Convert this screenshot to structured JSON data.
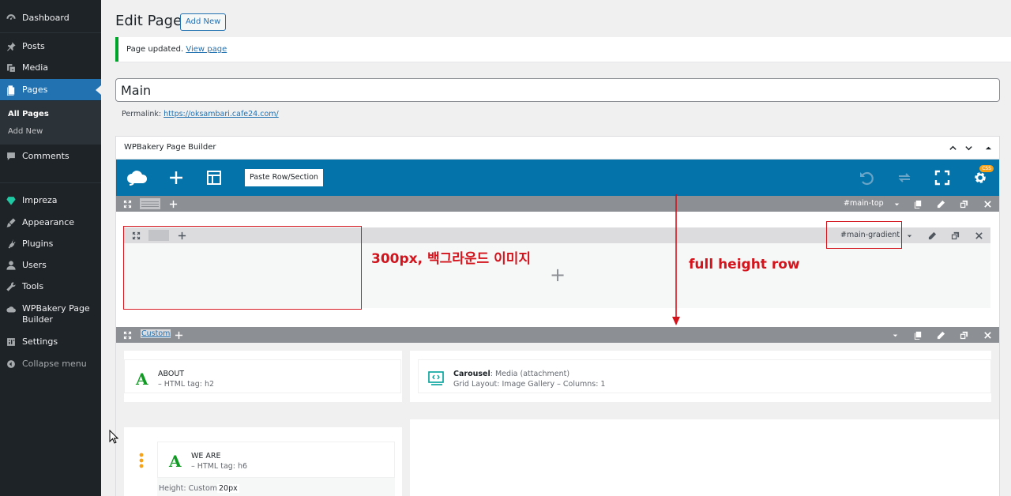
{
  "sidebar": {
    "items": [
      {
        "label": "Dashboard",
        "icon": "dashboard-icon"
      },
      {
        "label": "Posts",
        "icon": "pin-icon"
      },
      {
        "label": "Media",
        "icon": "media-icon"
      },
      {
        "label": "Pages",
        "icon": "pages-icon"
      },
      {
        "label": "Comments",
        "icon": "comment-icon"
      },
      {
        "label": "Impreza",
        "icon": "diamond-icon"
      },
      {
        "label": "Appearance",
        "icon": "brush-icon"
      },
      {
        "label": "Plugins",
        "icon": "plug-icon"
      },
      {
        "label": "Users",
        "icon": "user-icon"
      },
      {
        "label": "Tools",
        "icon": "wrench-icon"
      },
      {
        "label": "WPBakery Page Builder",
        "icon": "cloud-icon"
      },
      {
        "label": "Settings",
        "icon": "settings-icon"
      },
      {
        "label": "Collapse menu",
        "icon": "collapse-icon"
      }
    ],
    "submenu": [
      "All Pages",
      "Add New"
    ],
    "accent": "#2271b1"
  },
  "header": {
    "title": "Edit Page",
    "add_new": "Add New"
  },
  "notice": {
    "text": "Page updated.",
    "link": "View page"
  },
  "editor": {
    "title_value": "Main",
    "permalink_label": "Permalink:",
    "permalink_url": "https://oksambari.cafe24.com/"
  },
  "wpb": {
    "title": "WPBakery Page Builder",
    "paste_label": "Paste Row/Section",
    "css_badge": "CSS",
    "row1_id": "#main-top",
    "inner_id": "#main-gradient",
    "row2_label": "Custom",
    "toolbar_color": "#0473aa"
  },
  "annotations": {
    "a1": "300px, 백그라운드 이미지",
    "a2": "full height row",
    "color": "#d3141d"
  },
  "elements": [
    {
      "title": "ABOUT",
      "sub": "– HTML tag: h2"
    },
    {
      "title_bold": "Carousel",
      "title_rest": ": Media (attachment)",
      "sub": "Grid Layout: Image Gallery – Columns: 1"
    },
    {
      "title": "WE ARE",
      "sub": "– HTML tag: h6"
    }
  ],
  "height_info": {
    "label": "Height: Custom",
    "value": "20px"
  }
}
